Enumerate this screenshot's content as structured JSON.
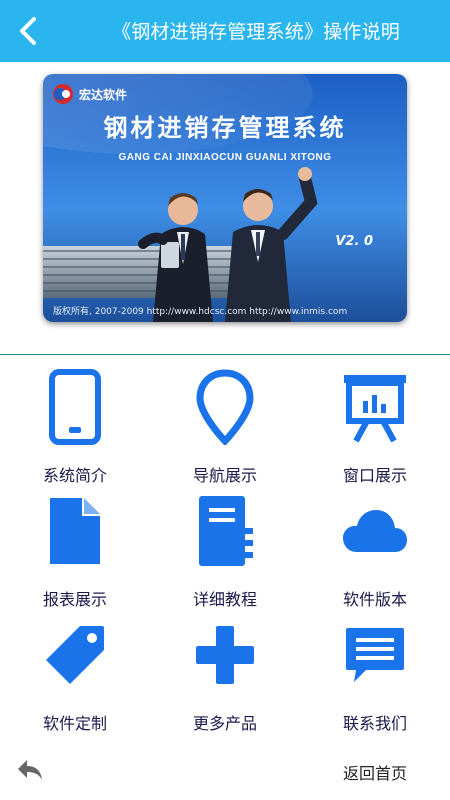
{
  "header": {
    "title": "《钢材进销存管理系统》操作说明",
    "back_icon": "chevron-left-icon"
  },
  "banner": {
    "company": "宏达软件",
    "product_title": "钢材进销存管理系统",
    "subtitle": "GANG CAI JINXIAOCUN GUANLI XITONG",
    "version": "V2. 0",
    "footer": "版权所有, 2007-2009   http://www.hdcsc.com    http://www.inmis.com"
  },
  "menu": [
    {
      "label": "系统简介",
      "icon": "phone-icon"
    },
    {
      "label": "导航展示",
      "icon": "map-pin-icon"
    },
    {
      "label": "窗口展示",
      "icon": "presentation-icon"
    },
    {
      "label": "报表展示",
      "icon": "document-icon"
    },
    {
      "label": "详细教程",
      "icon": "notebook-icon"
    },
    {
      "label": "软件版本",
      "icon": "cloud-icon"
    },
    {
      "label": "软件定制",
      "icon": "tag-icon"
    },
    {
      "label": "更多产品",
      "icon": "plus-icon"
    },
    {
      "label": "联系我们",
      "icon": "message-icon"
    }
  ],
  "footer": {
    "home_label": "返回首页",
    "back_icon": "reply-arrow-icon"
  },
  "colors": {
    "header_bg": "#2bb5ee",
    "icon_blue": "#1a73e8",
    "label_text": "#1b1b4d"
  }
}
